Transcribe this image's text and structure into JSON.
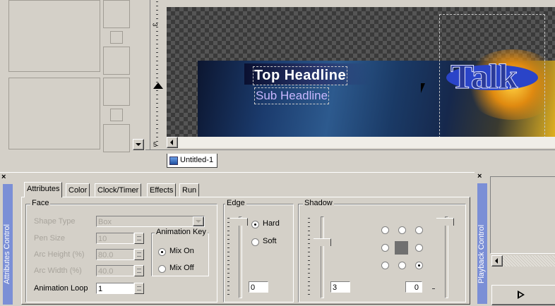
{
  "thumbnails": {
    "scroll_down_icon": "down-arrow-icon"
  },
  "ruler": {
    "marks": [
      "3",
      "5"
    ]
  },
  "preview": {
    "top_headline": "Top Headline",
    "sub_headline": "Sub Headline",
    "logo_text": "Talk"
  },
  "doc_tab": {
    "label": "Untitled-1"
  },
  "left_panel": {
    "title": "Attributes Control",
    "close": "×"
  },
  "tabs": [
    "Attributes",
    "Color",
    "Clock/Timer",
    "Effects",
    "Run"
  ],
  "face": {
    "title": "Face",
    "shape_type_label": "Shape Type",
    "shape_type_value": "Box",
    "pen_size_label": "Pen Size",
    "pen_size_value": "10",
    "arc_height_label": "Arc Height (%)",
    "arc_height_value": "80.0",
    "arc_width_label": "Arc Width (%)",
    "arc_width_value": "40.0",
    "animation_loop_label": "Animation Loop",
    "animation_loop_value": "1"
  },
  "animation_key": {
    "title": "Animation Key",
    "options": [
      "Mix On",
      "Mix Off"
    ],
    "selected": "Mix On"
  },
  "edge": {
    "title": "Edge",
    "options": [
      "Hard",
      "Soft"
    ],
    "selected": "Hard",
    "value": "0"
  },
  "shadow": {
    "title": "Shadow",
    "size_value": "3",
    "offset_value": "0",
    "direction_selected": "bottom-right",
    "color": "#707070"
  },
  "right_panel": {
    "title": "Playback Control",
    "close": "×",
    "play_icon": "play-icon"
  },
  "colors": {
    "accent_bar": "#7b8fd6",
    "canvas_dark": "#1a2a4a"
  }
}
